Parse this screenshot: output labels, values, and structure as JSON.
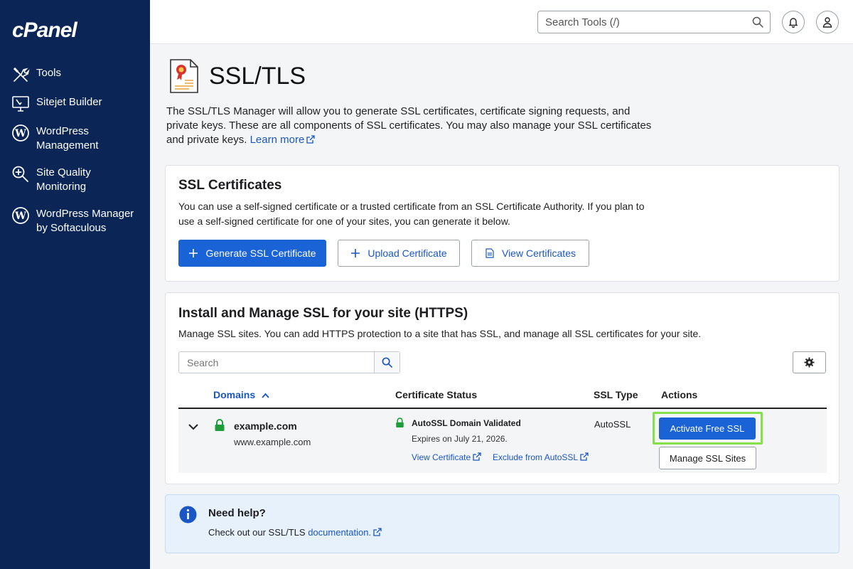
{
  "brand": {
    "logo_text": "cPanel"
  },
  "sidebar": {
    "items": [
      {
        "label": "Tools",
        "icon": "tools-icon"
      },
      {
        "label": "Sitejet Builder",
        "icon": "monitor-icon"
      },
      {
        "label": "WordPress Management",
        "icon": "wordpress-icon"
      },
      {
        "label": "Site Quality Monitoring",
        "icon": "magnifier-plus-icon"
      },
      {
        "label": "WordPress Manager by Softaculous",
        "icon": "wordpress-icon"
      }
    ]
  },
  "topbar": {
    "search_placeholder": "Search Tools (/)"
  },
  "page": {
    "title": "SSL/TLS",
    "intro": "The SSL/TLS Manager will allow you to generate SSL certificates, certificate signing requests, and private keys. These are all components of SSL certificates. You may also manage your SSL certificates and private keys.",
    "learn_more": "Learn more"
  },
  "ssl_certificates": {
    "title": "SSL Certificates",
    "description": "You can use a self-signed certificate or a trusted certificate from an SSL Certificate Authority. If you plan to use a self-signed certificate for one of your sites, you can generate it below.",
    "generate_label": "Generate SSL Certificate",
    "upload_label": "Upload Certificate",
    "view_label": "View Certificates"
  },
  "manage_ssl": {
    "title": "Install and Manage SSL for your site (HTTPS)",
    "description": "Manage SSL sites. You can add HTTPS protection to a site that has SSL, and manage all SSL certificates for your site.",
    "search_placeholder": "Search",
    "columns": {
      "domains": "Domains",
      "status": "Certificate Status",
      "type": "SSL Type",
      "actions": "Actions"
    },
    "rows": [
      {
        "domain": "example.com",
        "alias": "www.example.com",
        "status": "AutoSSL Domain Validated",
        "expires": "Expires on July 21, 2026.",
        "view_cert": "View Certificate",
        "exclude": "Exclude from AutoSSL",
        "ssl_type": "AutoSSL",
        "activate_label": "Activate Free SSL",
        "manage_label": "Manage SSL Sites"
      }
    ]
  },
  "help": {
    "title": "Need help?",
    "text": "Check out our SSL/TLS",
    "link": "documentation."
  },
  "colors": {
    "sidebar": "#0a2556",
    "primary": "#1a63d6",
    "link": "#1a56c4",
    "success": "#1f9d3a",
    "highlight": "#86e04a"
  }
}
